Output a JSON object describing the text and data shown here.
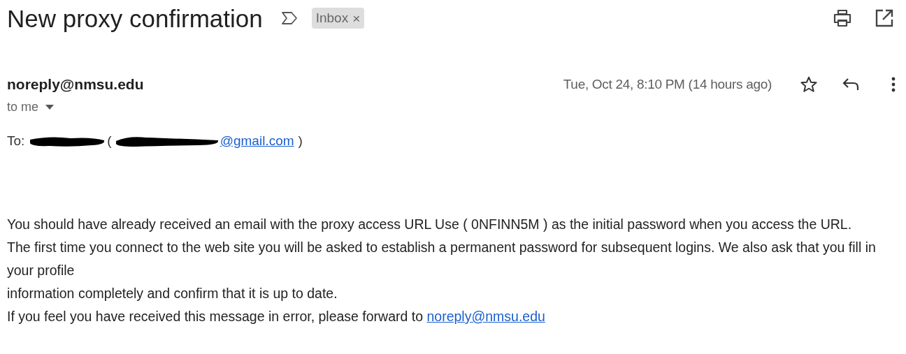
{
  "subject": "New proxy confirmation",
  "label": {
    "text": "Inbox",
    "close": "×"
  },
  "sender": "noreply@nmsu.edu",
  "recipient_line": "to me",
  "date": "Tue, Oct 24, 8:10 PM (14 hours ago)",
  "starred": false,
  "to_line": {
    "prefix": "To:",
    "open": "(",
    "email": "@gmail.com",
    "close": ")"
  },
  "body": [
    {
      "text": "You should have already received an email with the proxy access URL Use ( 0NFINN5M ) as the initial password when you access the URL."
    },
    {
      "text": "The first time you connect to the web site you will be asked to establish a permanent password for subsequent logins. We also ask that you fill in your profile"
    },
    {
      "text": "information completely and confirm that it is up to date."
    },
    {
      "text": "If you feel you have received this message in error, please forward to",
      "link": "noreply@nmsu.edu"
    }
  ]
}
